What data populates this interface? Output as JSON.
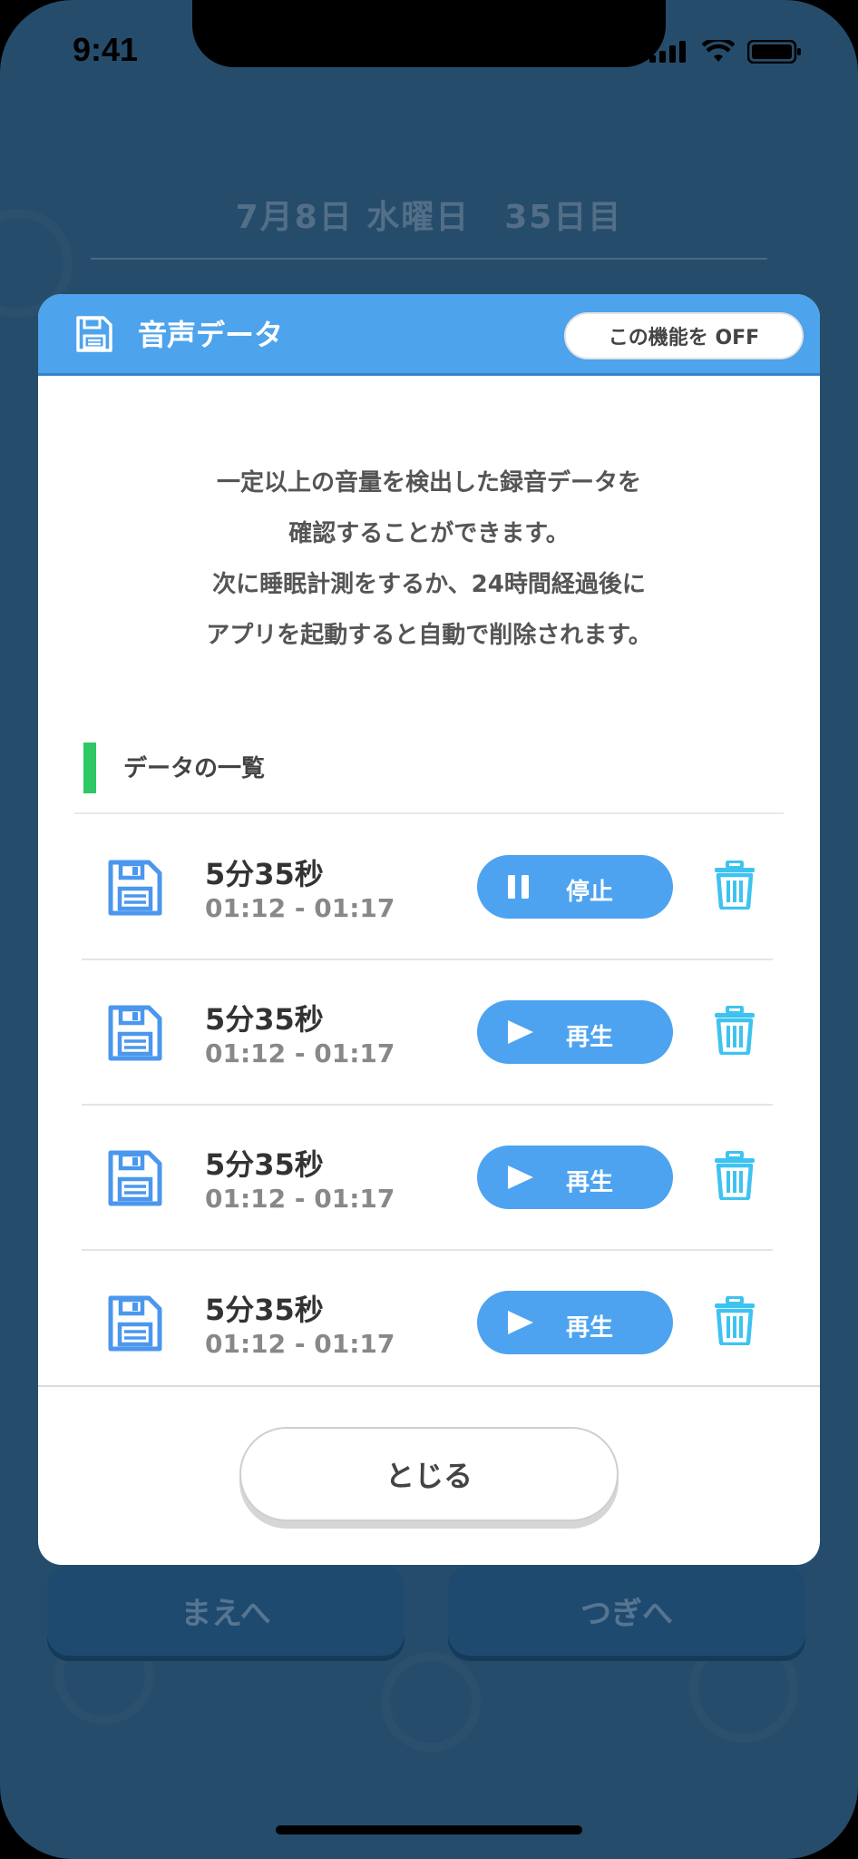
{
  "status_bar": {
    "time": "9:41"
  },
  "background": {
    "date_title": "7月8日 水曜日　35日目",
    "prev_button": "まえへ",
    "next_button": "つぎへ"
  },
  "modal": {
    "title": "音声データ",
    "toggle_button": "この機能を OFF",
    "description_lines": [
      "一定以上の音量を検出した録音データを",
      "確認することができます。",
      "次に睡眠計測をするか、24時間経過後に",
      "アプリを起動すると自動で削除されます。"
    ],
    "section_title": "データの一覧",
    "recordings": [
      {
        "duration": "5分35秒",
        "range": "01:12 - 01:17",
        "action": "停止",
        "action_icon": "pause-icon"
      },
      {
        "duration": "5分35秒",
        "range": "01:12 - 01:17",
        "action": "再生",
        "action_icon": "play-icon"
      },
      {
        "duration": "5分35秒",
        "range": "01:12 - 01:17",
        "action": "再生",
        "action_icon": "play-icon"
      },
      {
        "duration": "5分35秒",
        "range": "01:12 - 01:17",
        "action": "再生",
        "action_icon": "play-icon"
      }
    ],
    "close_button": "とじる"
  },
  "colors": {
    "background": "#264c6b",
    "header": "#4da3ec",
    "action_button": "#4da3f0",
    "section_accent": "#2ec866",
    "trash_icon": "#3ec3f0",
    "floppy_icon": "#4b97ee"
  }
}
